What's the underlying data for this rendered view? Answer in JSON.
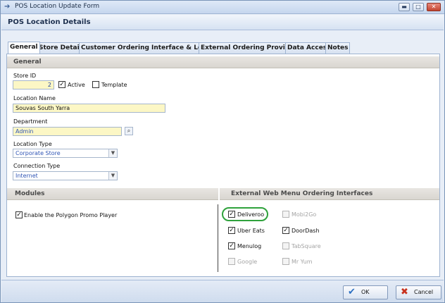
{
  "window": {
    "title": "POS Location Update Form",
    "controls": {
      "minimize": "▬",
      "maximize": "□",
      "close": "✕"
    }
  },
  "header": {
    "title": "POS Location Details"
  },
  "tabs": [
    {
      "label": "General",
      "active": true
    },
    {
      "label": "Store Details",
      "active": false
    },
    {
      "label": "Customer Ordering Interface & Loyalty",
      "active": false
    },
    {
      "label": "External Ordering Providers",
      "active": false
    },
    {
      "label": "Data Access",
      "active": false
    },
    {
      "label": "Notes",
      "active": false
    }
  ],
  "general": {
    "section_title": "General",
    "store_id": {
      "label": "Store ID",
      "value": "2"
    },
    "active": {
      "label": "Active",
      "checked": true
    },
    "template": {
      "label": "Template",
      "checked": false
    },
    "location_name": {
      "label": "Location Name",
      "value": "Souvas South Yarra"
    },
    "department": {
      "label": "Department",
      "value": "Admin"
    },
    "location_type": {
      "label": "Location Type",
      "value": "Corporate Store"
    },
    "connection_type": {
      "label": "Connection Type",
      "value": "Internet"
    }
  },
  "modules": {
    "section_title": "Modules",
    "promo_player": {
      "label": "Enable the Polygon Promo Player",
      "checked": true
    }
  },
  "external": {
    "section_title": "External Web Menu Ordering Interfaces",
    "items": [
      {
        "label": "Deliveroo",
        "checked": true,
        "enabled": true
      },
      {
        "label": "Mobi2Go",
        "checked": false,
        "enabled": false
      },
      {
        "label": "Uber Eats",
        "checked": true,
        "enabled": true
      },
      {
        "label": "DoorDash",
        "checked": true,
        "enabled": true
      },
      {
        "label": "Menulog",
        "checked": true,
        "enabled": true
      },
      {
        "label": "TabSquare",
        "checked": false,
        "enabled": false
      },
      {
        "label": "Google",
        "checked": false,
        "enabled": false
      },
      {
        "label": "Mr Yum",
        "checked": false,
        "enabled": false
      }
    ]
  },
  "footer": {
    "ok": {
      "label": "OK",
      "icon": "checkmark-icon"
    },
    "cancel": {
      "label": "Cancel",
      "icon": "cross-icon"
    }
  },
  "colors": {
    "accent": "#2f55b5",
    "highlight": "#2fa23c",
    "required_field": "#fcf7c5"
  }
}
